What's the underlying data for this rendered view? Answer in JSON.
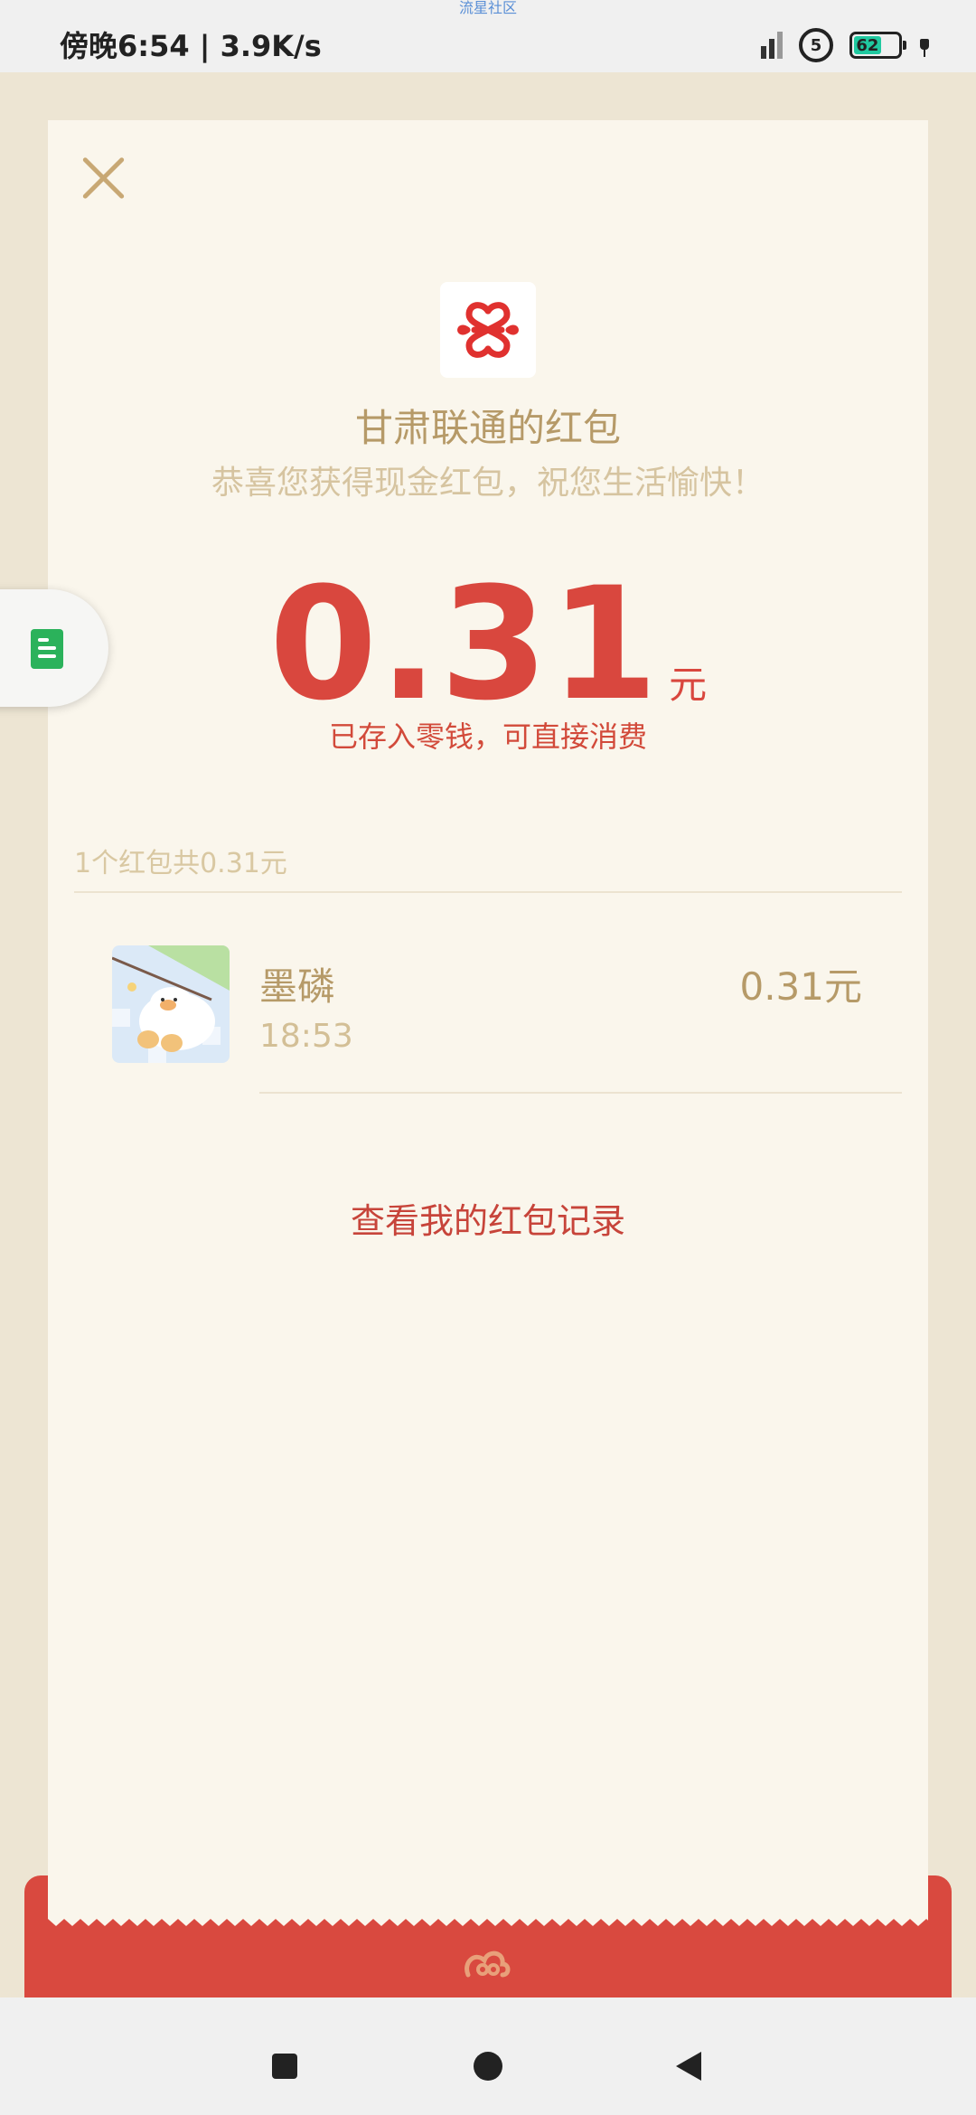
{
  "status_bar": {
    "watermark": "流星社区",
    "time": "傍晚6:54 | 3.9K/s",
    "alarm_label": "5",
    "battery_level": "62",
    "battery_color": "#20c9a0"
  },
  "envelope": {
    "sender_name": "甘肃联通的红包",
    "greeting": "恭喜您获得现金红包，祝您生活愉快！",
    "amount": "0.31",
    "unit": "元",
    "stored_note": "已存入零钱，可直接消费",
    "summary": "1个红包共0.31元",
    "records_link": "查看我的红包记录",
    "accent_color": "#d9473e"
  },
  "receiver": {
    "name": "墨磷",
    "time": "18:53",
    "amount": "0.31元"
  },
  "icons": {
    "close": "close-icon",
    "sender_logo": "china-unicom-logo",
    "float": "document-icon",
    "nav_recent": "square-recents-icon",
    "nav_home": "circle-home-icon",
    "nav_back": "triangle-back-icon"
  }
}
